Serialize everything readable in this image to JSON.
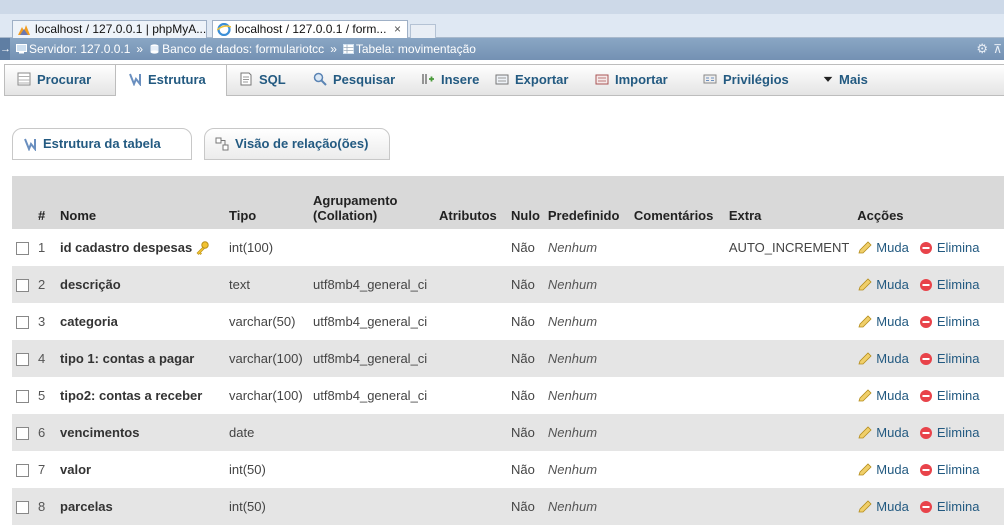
{
  "browser": {
    "tabs": [
      {
        "title": "localhost / 127.0.0.1 | phpMyA..."
      },
      {
        "title": "localhost / 127.0.0.1 / form...",
        "close": "×"
      }
    ]
  },
  "breadcrumb": {
    "server": "Servidor: 127.0.0.1",
    "database": "Banco de dados: formulariotcc",
    "table": "Tabela: movimentação",
    "separator": "»"
  },
  "menu": {
    "items": [
      {
        "label": "Procurar",
        "icon": "browse-icon"
      },
      {
        "label": "Estrutura",
        "icon": "structure-icon",
        "active": true
      },
      {
        "label": "SQL",
        "icon": "sql-icon"
      },
      {
        "label": "Pesquisar",
        "icon": "search-icon"
      },
      {
        "label": "Insere",
        "icon": "insert-icon"
      },
      {
        "label": "Exportar",
        "icon": "export-icon"
      },
      {
        "label": "Importar",
        "icon": "import-icon"
      },
      {
        "label": "Privilégios",
        "icon": "privileges-icon"
      },
      {
        "label": "Mais",
        "icon": "caret-down-icon"
      }
    ]
  },
  "subtabs": {
    "structure": "Estrutura da tabela",
    "relation": "Visão de relação(ões)"
  },
  "table": {
    "headers": {
      "hash": "#",
      "name": "Nome",
      "type": "Tipo",
      "collation_1": "Agrupamento",
      "collation_2": "(Collation)",
      "attributes": "Atributos",
      "null": "Nulo",
      "default": "Predefinido",
      "comments": "Comentários",
      "extra": "Extra",
      "actions": "Acções"
    },
    "action_change": "Muda",
    "action_drop": "Elimina",
    "rows": [
      {
        "num": "1",
        "name": "id cadastro despesas",
        "type": "int(100)",
        "collation": "",
        "attributes": "",
        "null": "Não",
        "default": "Nenhum",
        "comments": "",
        "extra": "AUTO_INCREMENT",
        "primary": true
      },
      {
        "num": "2",
        "name": "descrição",
        "type": "text",
        "collation": "utf8mb4_general_ci",
        "attributes": "",
        "null": "Não",
        "default": "Nenhum",
        "comments": "",
        "extra": ""
      },
      {
        "num": "3",
        "name": "categoria",
        "type": "varchar(50)",
        "collation": "utf8mb4_general_ci",
        "attributes": "",
        "null": "Não",
        "default": "Nenhum",
        "comments": "",
        "extra": ""
      },
      {
        "num": "4",
        "name": "tipo 1: contas a pagar",
        "type": "varchar(100)",
        "collation": "utf8mb4_general_ci",
        "attributes": "",
        "null": "Não",
        "default": "Nenhum",
        "comments": "",
        "extra": ""
      },
      {
        "num": "5",
        "name": "tipo2: contas a receber",
        "type": "varchar(100)",
        "collation": "utf8mb4_general_ci",
        "attributes": "",
        "null": "Não",
        "default": "Nenhum",
        "comments": "",
        "extra": ""
      },
      {
        "num": "6",
        "name": "vencimentos",
        "type": "date",
        "collation": "",
        "attributes": "",
        "null": "Não",
        "default": "Nenhum",
        "comments": "",
        "extra": ""
      },
      {
        "num": "7",
        "name": "valor",
        "type": "int(50)",
        "collation": "",
        "attributes": "",
        "null": "Não",
        "default": "Nenhum",
        "comments": "",
        "extra": ""
      },
      {
        "num": "8",
        "name": "parcelas",
        "type": "int(50)",
        "collation": "",
        "attributes": "",
        "null": "Não",
        "default": "Nenhum",
        "comments": "",
        "extra": ""
      }
    ]
  },
  "colors": {
    "link": "#235a81",
    "breadcrumb_bg": "#7f9cbd",
    "row_alt": "#e5e5e5",
    "drop_icon": "#e8434a",
    "edit_icon": "#e3b341"
  }
}
